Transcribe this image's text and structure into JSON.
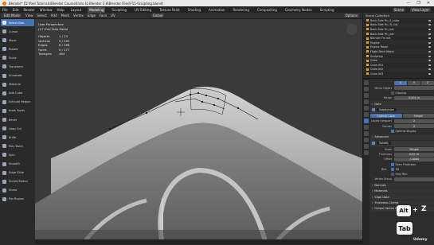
{
  "window": {
    "title": "Blender* [D:\\Red Tutorials\\Blender Course\\Intro to Blender 2.8\\Blender Files\\F15-Sculpting.blend]",
    "controls": [
      "—",
      "❐",
      "✕"
    ]
  },
  "topbar": {
    "menus": [
      "File",
      "Edit",
      "Render",
      "Window",
      "Help"
    ],
    "tabs": [
      "Layout",
      "Modeling",
      "Sculpting",
      "UV Editing",
      "Texture Paint",
      "Shading",
      "Animation",
      "Rendering",
      "Compositing",
      "Geometry Nodes",
      "Scripting"
    ],
    "active_tab": "Modeling",
    "scene": "Scene",
    "view_layer": "View Layer"
  },
  "header2": {
    "mode": "Edit Mode",
    "items": [
      "View",
      "Select",
      "Add",
      "Mesh",
      "Vertex",
      "Edge",
      "Face",
      "UV"
    ],
    "transform": "Global",
    "options": "Options"
  },
  "toolbar": {
    "tools": [
      "Select Box",
      "Cursor",
      "Move",
      "Rotate",
      "Scale",
      "Transform",
      "Annotate",
      "Measure",
      "Add Cube",
      "Extrude Region",
      "Inset Faces",
      "Bevel",
      "Loop Cut",
      "Knife",
      "Poly Build",
      "Spin",
      "Smooth",
      "Edge Slide",
      "Shrink/Fatten",
      "Shear",
      "Rip Region"
    ],
    "active_index": 0
  },
  "viewport": {
    "view_name": "User Perspective",
    "object_line": "(17) Full Tank Metal",
    "stats": [
      {
        "label": "Objects",
        "value": "1 / 23"
      },
      {
        "label": "Vertices",
        "value": "9 / 293"
      },
      {
        "label": "Edges",
        "value": "8 / 568"
      },
      {
        "label": "Faces",
        "value": "0 / 277"
      },
      {
        "label": "Triangles",
        "value": "464"
      }
    ]
  },
  "outliner": {
    "header": "Scene Collection",
    "rows": [
      "Back Side Fin_S_cube",
      "Back Side Fin_TL cut",
      "Back Side Fin_ext",
      "Back Side Fin_ext",
      "Blender Fin ext",
      "Engine",
      "Engine Room",
      "Flight Deck Metal",
      "Sculpting",
      "Cube",
      "Cube.001",
      "Cube.002",
      "Cube.003",
      "Cube.004",
      "Cube.005"
    ]
  },
  "properties": {
    "mirror_object_label": "Mirror Object",
    "clipping_label": "Clipping",
    "merge_label": "Merge",
    "merge_value": "0.001 m",
    "sections": [
      "Data",
      "Advanced"
    ],
    "subdivision": {
      "name": "Subdivision",
      "mode_labels": [
        "Catmull-Clark",
        "Simple"
      ],
      "levels_viewport_label": "Levels Viewport",
      "levels_viewport_value": "2",
      "render_label": "Render",
      "render_value": "2",
      "optimal_display": "Optimal Display"
    },
    "solidify": {
      "name": "Solidify",
      "mode_label": "Mode",
      "mode_value": "Simple",
      "thickness_label": "Thickness",
      "thickness_value": "0.01 m",
      "offset_label": "Offset",
      "offset_value": "-1.0000",
      "even_thickness": "Even Thickness",
      "rim_label": "Rim",
      "fill": "Fill",
      "only_rim": "Only Rim",
      "vertex_group": "Vertex Group"
    },
    "lower_sections": [
      "Normals",
      "Materials",
      "Edge Data",
      "Thickness Clamp",
      "Output Vertex Groups"
    ]
  },
  "overlay_keys": {
    "combo_keys": [
      "Alt",
      "+",
      "Z"
    ],
    "tab_key": "Tab"
  },
  "watermark": "Udemy"
}
